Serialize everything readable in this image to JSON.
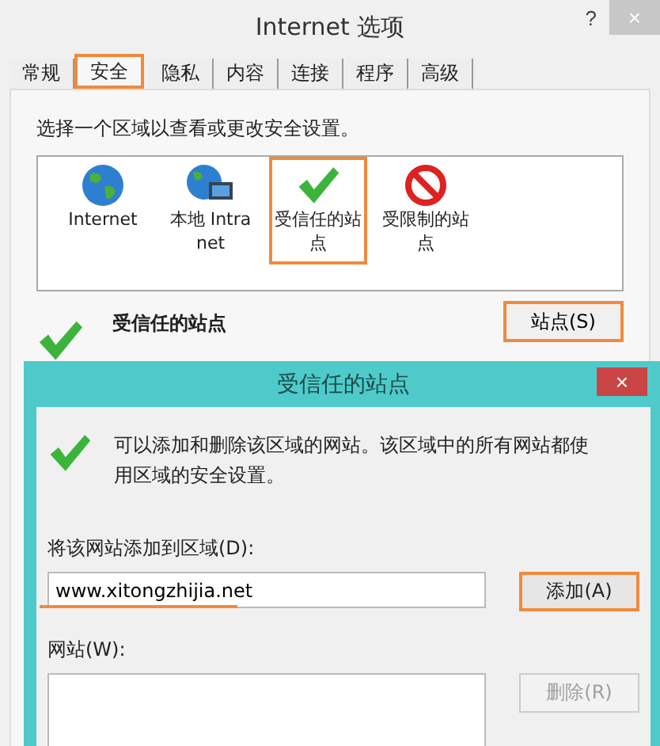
{
  "window": {
    "title": "Internet 选项",
    "help": "?",
    "close": "×"
  },
  "tabs": [
    {
      "label": "常规",
      "selected": false,
      "highlighted": false
    },
    {
      "label": "安全",
      "selected": true,
      "highlighted": true
    },
    {
      "label": "隐私",
      "selected": false,
      "highlighted": false
    },
    {
      "label": "内容",
      "selected": false,
      "highlighted": false
    },
    {
      "label": "连接",
      "selected": false,
      "highlighted": false
    },
    {
      "label": "程序",
      "selected": false,
      "highlighted": false
    },
    {
      "label": "高级",
      "selected": false,
      "highlighted": false
    }
  ],
  "zone_prompt": "选择一个区域以查看或更改安全设置。",
  "zones": [
    {
      "kind": "globe",
      "label": "Internet",
      "highlighted": false
    },
    {
      "kind": "intranet",
      "label": "本地 Intranet",
      "highlighted": false
    },
    {
      "kind": "trusted",
      "label": "受信任的站点",
      "highlighted": true
    },
    {
      "kind": "restricted",
      "label": "受限制的站点",
      "highlighted": false
    }
  ],
  "zone_detail": {
    "title": "受信任的站点",
    "button": {
      "label": "站点(S)",
      "highlighted": true
    }
  },
  "dialog": {
    "title": "受信任的站点",
    "close": "×",
    "info": "可以添加和删除该区域的网站。该区域中的所有网站都使用区域的安全设置。",
    "add_label": "将该网站添加到区域(D):",
    "add_value": "www.xitongzhijia.net",
    "add_value_underlined": true,
    "add_button": {
      "label": "添加(A)",
      "highlighted": true,
      "disabled": false
    },
    "list_label": "网站(W):",
    "remove_button": {
      "label": "删除(R)",
      "highlighted": false,
      "disabled": true
    }
  }
}
